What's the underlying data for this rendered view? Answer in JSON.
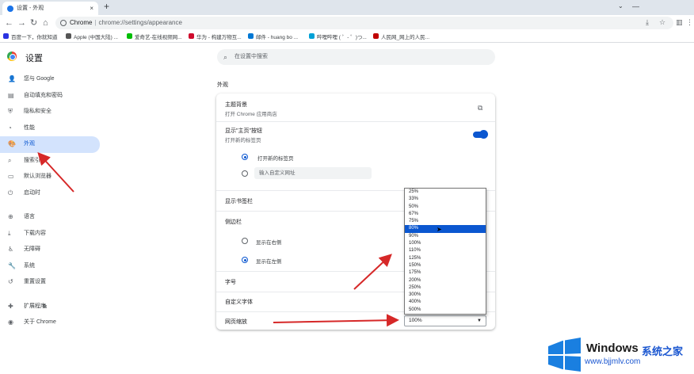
{
  "browser": {
    "tab_title": "设置 - 外观",
    "tab_close": "×",
    "new_tab": "+",
    "url_prefix": "Chrome",
    "url": "chrome://settings/appearance",
    "bookmarks": [
      {
        "label": "百度一下，你就知道",
        "color": "#2932e1"
      },
      {
        "label": "Apple (中国大陆) ...",
        "color": "#555555"
      },
      {
        "label": "爱奇艺-在线视频网...",
        "color": "#00be06"
      },
      {
        "label": "华为 - 构建万物互...",
        "color": "#cf0a2c"
      },
      {
        "label": "邮件 - huang bo ...",
        "color": "#0078d4"
      },
      {
        "label": "哔哩哔哩 ( ゜- ゜)つ...",
        "color": "#00a1d6"
      },
      {
        "label": "人民网_网上的人民...",
        "color": "#c00000"
      }
    ]
  },
  "sidebar": {
    "title": "设置",
    "items": [
      {
        "label": "您与 Google",
        "icon": "person-icon",
        "glyph": "👤"
      },
      {
        "label": "自动填充和密码",
        "icon": "autofill-icon",
        "glyph": "▤"
      },
      {
        "label": "隐私和安全",
        "icon": "shield-icon",
        "glyph": "⛨"
      },
      {
        "label": "性能",
        "icon": "speedometer-icon",
        "glyph": "◔"
      },
      {
        "label": "外观",
        "icon": "palette-icon",
        "glyph": "🎨",
        "active": true
      },
      {
        "label": "搜索引擎",
        "icon": "search-icon",
        "glyph": "⌕"
      },
      {
        "label": "默认浏览器",
        "icon": "browser-icon",
        "glyph": "▭"
      },
      {
        "label": "启动时",
        "icon": "power-icon",
        "glyph": "⏻"
      },
      {
        "label": "语言",
        "icon": "globe-icon",
        "glyph": "⊕"
      },
      {
        "label": "下载内容",
        "icon": "download-icon",
        "glyph": "⤓"
      },
      {
        "label": "无障碍",
        "icon": "accessibility-icon",
        "glyph": "♿"
      },
      {
        "label": "系统",
        "icon": "wrench-icon",
        "glyph": "🔧"
      },
      {
        "label": "重置设置",
        "icon": "reset-icon",
        "glyph": "↺"
      },
      {
        "label": "扩展程序",
        "icon": "puzzle-icon",
        "glyph": "✚"
      },
      {
        "label": "关于 Chrome",
        "icon": "chrome-icon",
        "glyph": "◉"
      }
    ]
  },
  "search": {
    "placeholder": "在设置中搜索"
  },
  "main": {
    "section_title": "外观",
    "theme": {
      "label": "主题背景",
      "sub": "打开 Chrome 应用商店"
    },
    "home_button": {
      "label": "显示\"主页\"按钮",
      "sub": "打开新的标签页",
      "enabled": true
    },
    "home_options": {
      "new_tab": "打开新的标签页",
      "custom_url_placeholder": "输入自定义网址"
    },
    "bookmarks_bar": {
      "label": "显示书签栏"
    },
    "side_panel": {
      "label": "侧边栏",
      "right": "显示在右侧",
      "left": "显示在左侧"
    },
    "font_size": {
      "label": "字号"
    },
    "custom_fonts": {
      "label": "自定义字体"
    },
    "page_zoom": {
      "label": "网页缩放",
      "value": "100%",
      "options": [
        "25%",
        "33%",
        "50%",
        "67%",
        "75%",
        "80%",
        "90%",
        "100%",
        "110%",
        "125%",
        "150%",
        "175%",
        "200%",
        "250%",
        "300%",
        "400%",
        "500%"
      ],
      "highlighted": "80%"
    }
  },
  "watermark": {
    "brand": "Windows",
    "cn": "系统之家",
    "url": "www.bjjmlv.com"
  }
}
